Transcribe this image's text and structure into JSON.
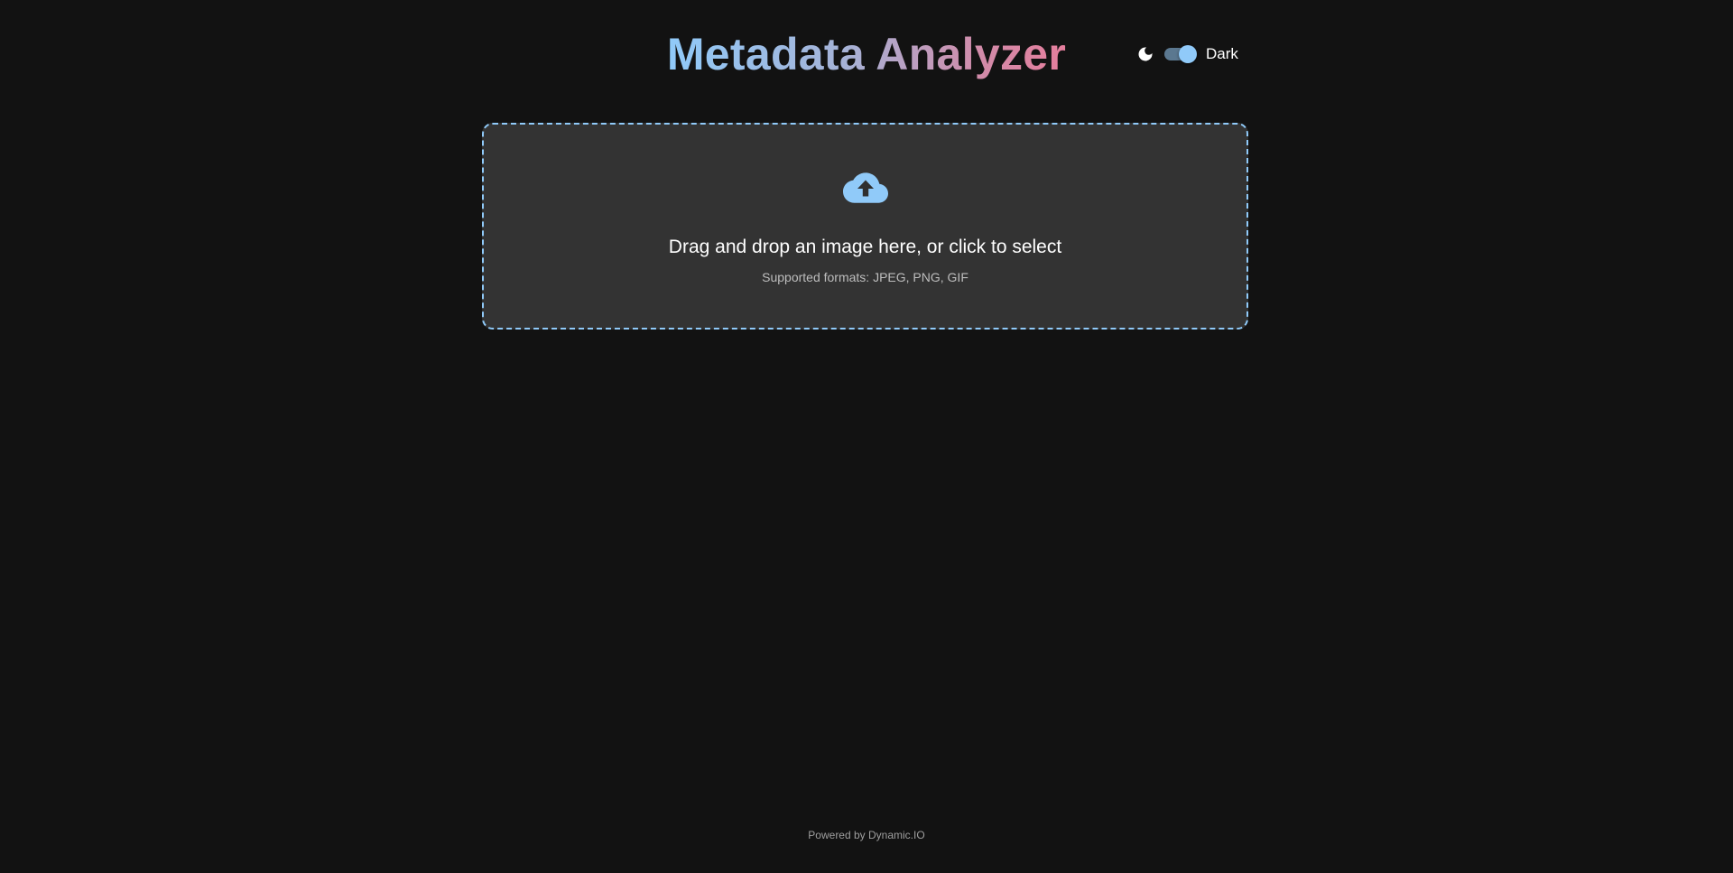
{
  "header": {
    "title": "Metadata Analyzer",
    "theme_toggle": {
      "icon": "moon-icon",
      "label": "Dark",
      "checked": true
    }
  },
  "upload": {
    "icon": "cloud-upload-icon",
    "primary_text": "Drag and drop an image here, or click to select",
    "secondary_text": "Supported formats: JPEG, PNG, GIF"
  },
  "footer": {
    "text": "Powered by Dynamic.IO"
  },
  "colors": {
    "background": "#121212",
    "surface": "#333333",
    "accent": "#90caf9",
    "title_gradient_end": "#e57e9d"
  }
}
